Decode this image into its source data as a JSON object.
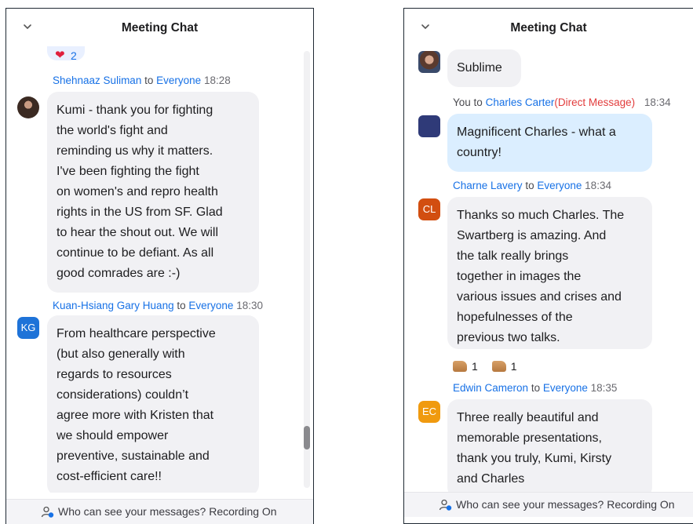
{
  "left_panel": {
    "title": "Meeting Chat",
    "top_reaction": {
      "count": "2"
    },
    "messages": [
      {
        "sender": "Shehnaaz Suliman",
        "to_word": "to",
        "recipient": "Everyone",
        "time": "18:28",
        "lines": [
          "Kumi - thank you for fighting",
          "the world's fight and",
          "reminding us why it matters.",
          "I've been fighting the fight",
          "on women's and repro health",
          "rights in the US from SF. Glad",
          "to hear the shout out. We will",
          "continue to be defiant. As all",
          "good comrades are :-)"
        ]
      },
      {
        "sender": "Kuan-Hsiang Gary Huang",
        "to_word": "to",
        "recipient": "Everyone",
        "time": "18:30",
        "avatar": "KG",
        "avatar_color": "#1e73d8",
        "lines": [
          "From healthcare perspective",
          "(but also generally with",
          "regards to resources",
          "considerations) couldn’t",
          "agree more with Kristen that",
          "we should empower",
          "preventive, sustainable and",
          "cost-efficient care!!"
        ]
      }
    ],
    "footer": "Who can see your messages? Recording On"
  },
  "right_panel": {
    "title": "Meeting Chat",
    "messages": [
      {
        "lines": [
          "Sublime"
        ]
      },
      {
        "sender": "You",
        "to_word": "to",
        "recipient": "Charles Carter",
        "direct": "(Direct Message)",
        "time": "18:34",
        "lines": [
          "Magnificent Charles - what a",
          "country!"
        ]
      },
      {
        "sender": "Charne Lavery",
        "to_word": "to",
        "recipient": "Everyone",
        "time": "18:34",
        "avatar": "CL",
        "avatar_color": "#d24e10",
        "lines": [
          "Thanks so much Charles. The",
          "Swartberg is amazing. And",
          "the talk really brings",
          "together in images the",
          "various issues and crises and",
          "hopefulnesses of the",
          "previous two talks."
        ],
        "reactions": [
          {
            "count": "1"
          },
          {
            "count": "1"
          }
        ]
      },
      {
        "sender": "Edwin Cameron",
        "to_word": "to",
        "recipient": "Everyone",
        "time": "18:35",
        "avatar": "EC",
        "avatar_color": "#f09a0f",
        "lines": [
          "Three really beautiful and",
          "memorable presentations,",
          "thank you truly, Kumi, Kirsty",
          "and Charles"
        ]
      }
    ],
    "footer": "Who can see your messages? Recording On"
  },
  "icons": {
    "collapse": "chevron-down-icon",
    "heart": "heart-icon",
    "thumbs_up": "thumbs-up-icon",
    "privacy": "user-visibility-icon"
  },
  "colors": {
    "name_link": "#1771e6",
    "direct_message": "#e23c3c",
    "bubble": "#f1f1f4",
    "bubble_self": "#dbeeff",
    "heart": "#e01f3d"
  }
}
